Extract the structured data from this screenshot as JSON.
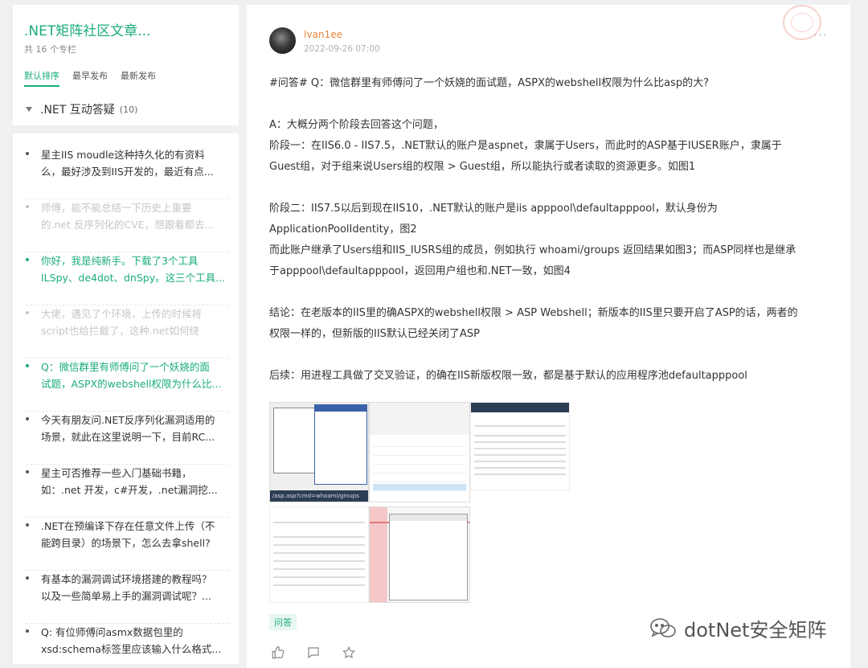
{
  "column": {
    "title": ".NET矩阵社区文章...",
    "count_text": "共 16 个专栏",
    "sort_tabs": [
      {
        "label": "默认排序",
        "active": true
      },
      {
        "label": "最早发布",
        "active": false
      },
      {
        "label": "最新发布",
        "active": false
      }
    ],
    "group": {
      "name": ".NET 互动答疑",
      "count": "(10)"
    }
  },
  "list": [
    {
      "line1": "星主IIS moudle这种持久化的有资料",
      "line2": "么，最好涉及到IIS开发的，最近有点...",
      "state": "normal"
    },
    {
      "line1": "师傅，能不能总结一下历史上重要",
      "line2": "的.net 反序列化的CVE，想跟着都去...",
      "state": "dim"
    },
    {
      "line1": "你好，我是纯新手。下载了3个工具",
      "line2": "ILSpy、de4dot、dnSpy。这三个工具...",
      "state": "active"
    },
    {
      "line1": "大佬，遇见了个环境，上传的时候将",
      "line2": "script也给拦截了，这种.net如何绕",
      "state": "dim"
    },
    {
      "line1": "Q：微信群里有师傅问了一个妖娆的面",
      "line2": "试题，ASPX的webshell权限为什么比...",
      "state": "active"
    },
    {
      "line1": "今天有朋友问.NET反序列化漏洞适用的",
      "line2": "场景，就此在这里说明一下，目前RC...",
      "state": "normal"
    },
    {
      "line1": "星主可否推荐一些入门基础书籍，",
      "line2": "如：.net 开发，c#开发，.net漏洞挖...",
      "state": "normal"
    },
    {
      "line1": ".NET在预编译下存在任意文件上传（不",
      "line2": "能跨目录）的场景下，怎么去拿shell?",
      "state": "normal"
    },
    {
      "line1": "有基本的漏洞调试环境搭建的教程吗？",
      "line2": "以及一些简单易上手的漏洞调试呢？...",
      "state": "normal"
    },
    {
      "line1": "Q: 有位师傅问asmx数据包里的",
      "line2": "xsd:schema标签里应该输入什么格式...",
      "state": "normal"
    }
  ],
  "post": {
    "author": "Ivan1ee",
    "time": "2022-09-26 07:00",
    "more": "···",
    "paragraphs": [
      "#问答# Q：微信群里有师傅问了一个妖娆的面试题，ASPX的webshell权限为什么比asp的大?",
      "",
      "A：大概分两个阶段去回答这个问题，",
      "阶段一：在IIS6.0 - IIS7.5，.NET默认的账户是aspnet，隶属于Users，而此时的ASP基于IUSER账户，隶属于",
      "Guest组，对于组来说Users组的权限 > Guest组，所以能执行或者读取的资源更多。如图1",
      "",
      "阶段二：IIS7.5以后到现在IIS10，.NET默认的账户是iis apppool\\defaultapppool，默认身份为",
      "ApplicationPoolIdentity，图2",
      "而此账户继承了Users组和IIS_IUSRS组的成员，例如执行 whoami/groups 返回结果如图3；而ASP同样也是继承",
      "于apppool\\defaultapppool，返回用户组也和.NET一致，如图4",
      "",
      "结论：在老版本的IIS里的确ASPX的webshell权限 > ASP Webshell；新版本的IIS里只要开启了ASP的话，两者的",
      "权限一样的，但新版的IIS默认已经关闭了ASP",
      "",
      "后续：用进程工具做了交叉验证，的确在IIS新版权限一致，都是基于默认的应用程序池defaultapppool"
    ],
    "screenshot_url_text": "/asp.asp?cmd=whoami/groups",
    "tag": "问答"
  },
  "watermark": "dotNet安全矩阵",
  "colors": {
    "accent": "#1aad7b",
    "author": "#e8833a",
    "dim": "#c6c6c6"
  }
}
